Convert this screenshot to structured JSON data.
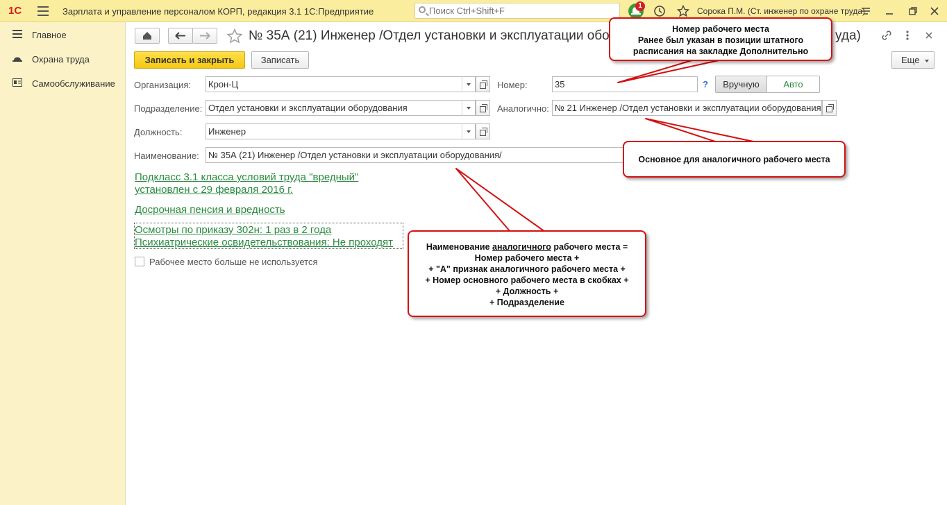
{
  "topbar": {
    "logo": "1С",
    "app_title": "Зарплата и управление персоналом КОРП, редакция 3.1 1С:Предприятие",
    "search_placeholder": "Поиск Ctrl+Shift+F",
    "notification_count": "1",
    "user": "Сорока П.М. (Ст. инженер по охране труда)"
  },
  "sidebar": {
    "items": [
      {
        "label": "Главное",
        "icon": "menu-lines-icon"
      },
      {
        "label": "Охрана труда",
        "icon": "hard-hat-icon"
      },
      {
        "label": "Самообслуживание",
        "icon": "id-card-icon"
      }
    ]
  },
  "form": {
    "title": "№ 35А (21) Инженер /Отдел установки и эксплуатации обору",
    "title_tail": "уда)",
    "save_close_label": "Записать и закрыть",
    "save_label": "Записать",
    "more_label": "Еще",
    "fields": {
      "organization_label": "Организация:",
      "organization_value": "Крон-Ц",
      "department_label": "Подразделение:",
      "department_value": "Отдел установки и эксплуатации оборудования",
      "position_label": "Должность:",
      "position_value": "Инженер",
      "name_label": "Наименование:",
      "name_value": "№ 35А (21) Инженер /Отдел установки и эксплуатации оборудования/",
      "number_label": "Номер:",
      "number_value": "35",
      "help": "?",
      "manual_label": "Вручную",
      "auto_label": "Авто",
      "analog_label": "Аналогично:",
      "analog_value": "№ 21 Инженер /Отдел установки и эксплуатации оборудования"
    },
    "links": {
      "subclass_line1": "Подкласс 3.1 класса условий труда \"вредный\"",
      "subclass_line2": "установлен с 29 февраля 2016 г.",
      "pension": "Досрочная пенсия и вредность",
      "exams_line1": "Осмотры по приказу 302н: 1 раз в 2 года",
      "exams_line2": "Психиатрические освидетельствования: Не проходят"
    },
    "checkbox_label": "Рабочее место больше не используется"
  },
  "callouts": {
    "number": [
      "Номер рабочего места",
      "Ранее был указан в позиции штатного",
      "расписания на закладке Дополнительно"
    ],
    "analog": "Основное для аналогичного рабочего места",
    "naming": {
      "line1_prefix": "Наименование ",
      "line1_underlined": "аналогичного",
      "line1_suffix": " рабочего места =",
      "lines": [
        "Номер рабочего места +",
        "+ \"А\" признак аналогичного рабочего места +",
        "+ Номер основного рабочего места в скобках +",
        "+ Должность +",
        "+ Подразделение"
      ]
    }
  },
  "colors": {
    "topbar": "#fbed9e",
    "sidebar": "#fbf3c7",
    "primary_button": "#f5c713",
    "link": "#2a8b3f",
    "callout_border": "#d41111"
  }
}
